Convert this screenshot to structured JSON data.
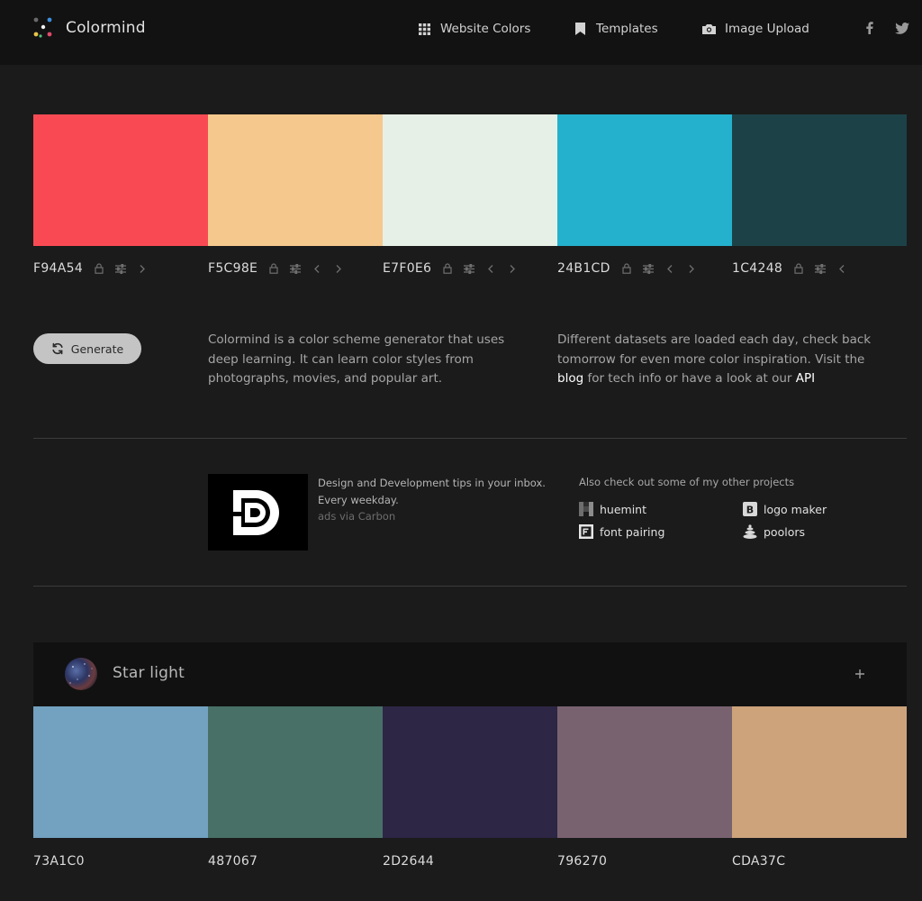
{
  "header": {
    "brand": "Colormind",
    "nav": [
      {
        "label": "Website Colors",
        "icon": "grid-icon"
      },
      {
        "label": "Templates",
        "icon": "bookmark-icon"
      },
      {
        "label": "Image Upload",
        "icon": "camera-icon"
      }
    ],
    "social": [
      "facebook-icon",
      "twitter-icon"
    ]
  },
  "palette": [
    {
      "hex": "F94A54",
      "color": "#F94A54"
    },
    {
      "hex": "F5C98E",
      "color": "#F5C98E"
    },
    {
      "hex": "E7F0E6",
      "color": "#E7F0E6"
    },
    {
      "hex": "24B1CD",
      "color": "#24B1CD"
    },
    {
      "hex": "1C4248",
      "color": "#1C4248"
    }
  ],
  "generate_label": "Generate",
  "intro": {
    "left": "Colormind is a color scheme generator that uses deep learning. It can learn color styles from photographs, movies, and popular art.",
    "right_a": "Different datasets are loaded each day, check back tomorrow for even more color inspiration. Visit the ",
    "blog_link": "blog",
    "right_b": " for tech info or have a look at our ",
    "api_link": "API"
  },
  "ad": {
    "line1": "Design and Development tips in your inbox.",
    "line2": "Every weekday.",
    "via": "ads via Carbon"
  },
  "projects": {
    "title": "Also check out some of my other projects",
    "items": [
      {
        "label": "huemint",
        "icon": "huemint-icon"
      },
      {
        "label": "logo maker",
        "icon": "logo-maker-icon"
      },
      {
        "label": "font pairing",
        "icon": "font-pairing-icon"
      },
      {
        "label": "poolors",
        "icon": "poolors-icon"
      }
    ]
  },
  "featured": {
    "title": "Star light",
    "palette": [
      {
        "hex": "73A1C0",
        "color": "#73A1C0"
      },
      {
        "hex": "487067",
        "color": "#487067"
      },
      {
        "hex": "2D2644",
        "color": "#2D2644"
      },
      {
        "hex": "796270",
        "color": "#796270"
      },
      {
        "hex": "CDA37C",
        "color": "#CDA37C"
      }
    ]
  }
}
